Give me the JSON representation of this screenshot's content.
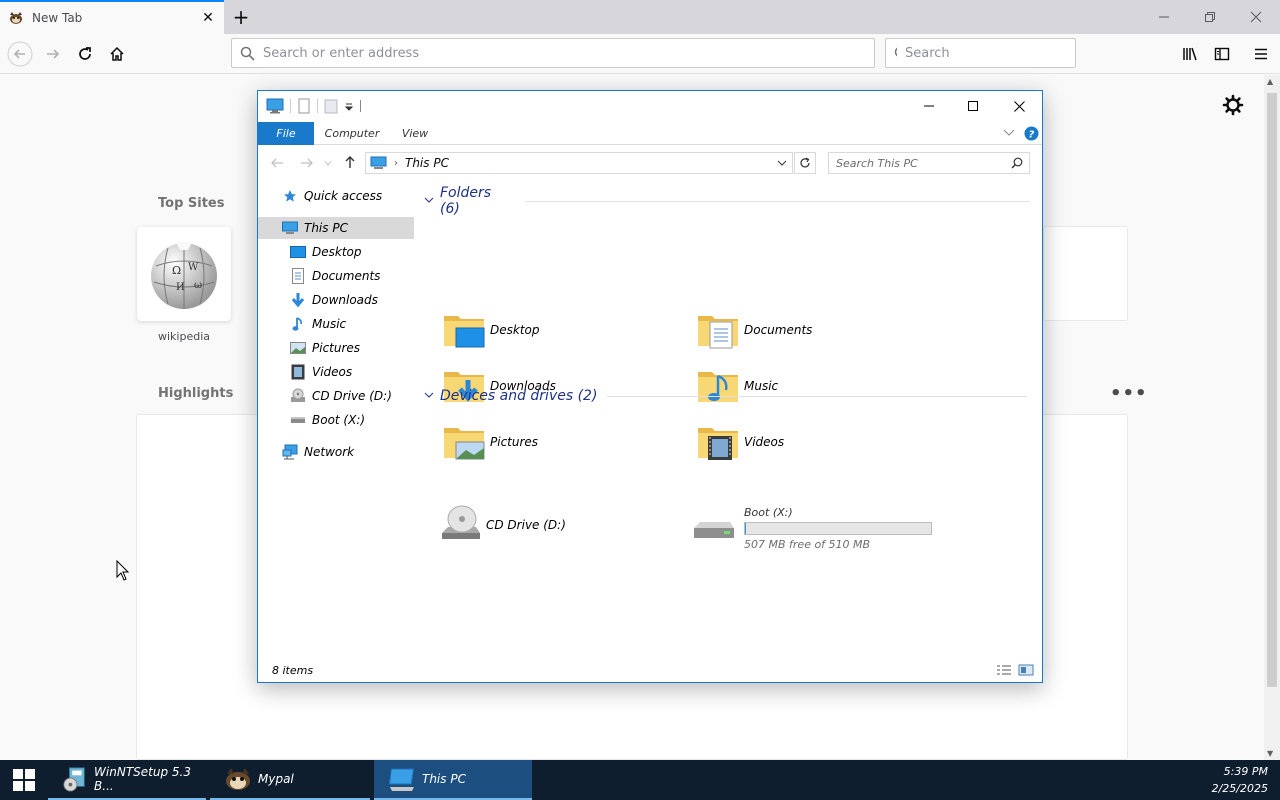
{
  "browser": {
    "tab": {
      "title": "New Tab"
    },
    "address_placeholder": "Search or enter address",
    "search_placeholder": "Search"
  },
  "newtab": {
    "top_sites_title": "Top Sites",
    "top_sites": [
      {
        "label": "wikipedia",
        "icon": "wikipedia-globe-icon"
      }
    ],
    "highlights_title": "Highlights",
    "more_label": "•••"
  },
  "explorer": {
    "ribbon_tabs": [
      "File",
      "Computer",
      "View"
    ],
    "breadcrumb": "This PC",
    "search_placeholder": "Search This PC",
    "nav": [
      {
        "label": "Quick access",
        "icon": "star-icon"
      },
      {
        "label": "This PC",
        "icon": "computer-icon"
      },
      {
        "label": "Desktop",
        "icon": "desktop-icon"
      },
      {
        "label": "Documents",
        "icon": "documents-icon"
      },
      {
        "label": "Downloads",
        "icon": "downloads-icon"
      },
      {
        "label": "Music",
        "icon": "music-icon"
      },
      {
        "label": "Pictures",
        "icon": "pictures-icon"
      },
      {
        "label": "Videos",
        "icon": "videos-icon"
      },
      {
        "label": "CD Drive (D:)",
        "icon": "cd-drive-icon"
      },
      {
        "label": "Boot (X:)",
        "icon": "drive-icon"
      },
      {
        "label": "Network",
        "icon": "network-icon"
      }
    ],
    "folders_header": "Folders (6)",
    "folders": [
      {
        "label": "Desktop",
        "icon": "desktop-folder-icon"
      },
      {
        "label": "Documents",
        "icon": "documents-folder-icon"
      },
      {
        "label": "Downloads",
        "icon": "downloads-folder-icon"
      },
      {
        "label": "Music",
        "icon": "music-folder-icon"
      },
      {
        "label": "Pictures",
        "icon": "pictures-folder-icon"
      },
      {
        "label": "Videos",
        "icon": "videos-folder-icon"
      }
    ],
    "devices_header": "Devices and drives (2)",
    "devices": [
      {
        "label": "CD Drive (D:)",
        "icon": "cd-drive-icon"
      },
      {
        "label": "Boot (X:)",
        "icon": "hard-drive-icon",
        "free_text": "507 MB free of 510 MB",
        "used_fraction": 0.006
      }
    ],
    "status": "8 items",
    "colors": {
      "accent": "#1979ca",
      "group_header": "#1e3287",
      "folder": "#f8d775"
    }
  },
  "taskbar": {
    "tasks": [
      {
        "label": "WinNTSetup 5.3 B...",
        "icon": "winntsetup-icon"
      },
      {
        "label": "Mypal",
        "icon": "mypal-icon"
      },
      {
        "label": "This PC",
        "icon": "this-pc-icon"
      }
    ],
    "time": "5:39 PM",
    "date": "2/25/2025"
  }
}
